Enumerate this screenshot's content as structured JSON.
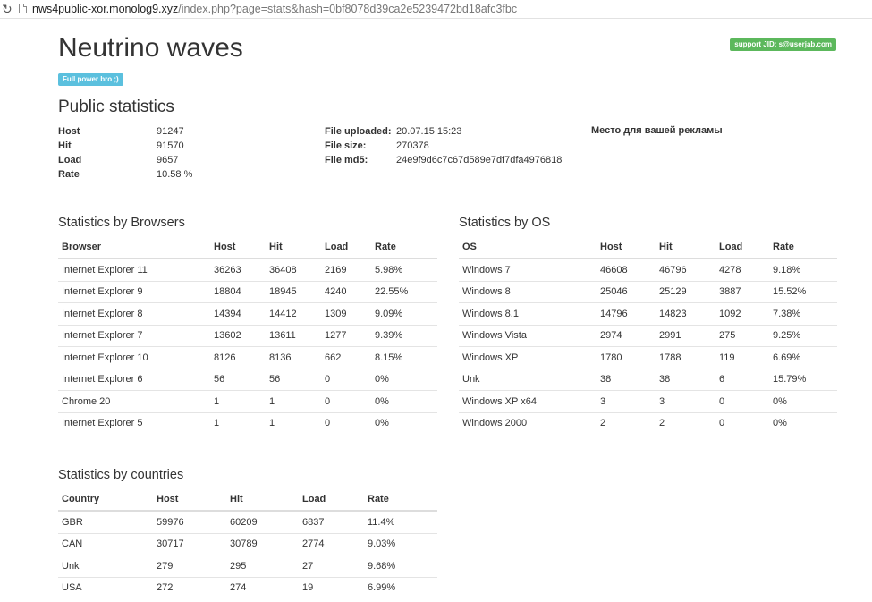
{
  "browser": {
    "url_domain": "nws4public-xor.monolog9.xyz",
    "url_path": "/index.php?page=stats&hash=0bf8078d39ca2e5239472bd18afc3fbc"
  },
  "header": {
    "title": "Neutrino waves",
    "badge": "Full power bro ;)",
    "support": "support JID: s@userjab.com"
  },
  "public_stats": {
    "title": "Public statistics",
    "summary": [
      {
        "label": "Host",
        "value": "91247"
      },
      {
        "label": "Hit",
        "value": "91570"
      },
      {
        "label": "Load",
        "value": "9657"
      },
      {
        "label": "Rate",
        "value": "10.58 %"
      }
    ],
    "file": [
      {
        "label": "File uploaded:",
        "value": "20.07.15 15:23"
      },
      {
        "label": "File size:",
        "value": "270378"
      },
      {
        "label": "File md5:",
        "value": "24e9f9d6c7c67d589e7df7dfa4976818"
      }
    ],
    "ad_text": "Место для вашей рекламы"
  },
  "browsers": {
    "title": "Statistics by Browsers",
    "columns": [
      "Browser",
      "Host",
      "Hit",
      "Load",
      "Rate"
    ],
    "rows": [
      [
        "Internet Explorer 11",
        "36263",
        "36408",
        "2169",
        "5.98%"
      ],
      [
        "Internet Explorer 9",
        "18804",
        "18945",
        "4240",
        "22.55%"
      ],
      [
        "Internet Explorer 8",
        "14394",
        "14412",
        "1309",
        "9.09%"
      ],
      [
        "Internet Explorer 7",
        "13602",
        "13611",
        "1277",
        "9.39%"
      ],
      [
        "Internet Explorer 10",
        "8126",
        "8136",
        "662",
        "8.15%"
      ],
      [
        "Internet Explorer 6",
        "56",
        "56",
        "0",
        "0%"
      ],
      [
        "Chrome 20",
        "1",
        "1",
        "0",
        "0%"
      ],
      [
        "Internet Explorer 5",
        "1",
        "1",
        "0",
        "0%"
      ]
    ]
  },
  "os": {
    "title": "Statistics by OS",
    "columns": [
      "OS",
      "Host",
      "Hit",
      "Load",
      "Rate"
    ],
    "rows": [
      [
        "Windows 7",
        "46608",
        "46796",
        "4278",
        "9.18%"
      ],
      [
        "Windows 8",
        "25046",
        "25129",
        "3887",
        "15.52%"
      ],
      [
        "Windows 8.1",
        "14796",
        "14823",
        "1092",
        "7.38%"
      ],
      [
        "Windows Vista",
        "2974",
        "2991",
        "275",
        "9.25%"
      ],
      [
        "Windows XP",
        "1780",
        "1788",
        "119",
        "6.69%"
      ],
      [
        "Unk",
        "38",
        "38",
        "6",
        "15.79%"
      ],
      [
        "Windows XP x64",
        "3",
        "3",
        "0",
        "0%"
      ],
      [
        "Windows 2000",
        "2",
        "2",
        "0",
        "0%"
      ]
    ]
  },
  "countries": {
    "title": "Statistics by countries",
    "columns": [
      "Country",
      "Host",
      "Hit",
      "Load",
      "Rate"
    ],
    "rows": [
      [
        "GBR",
        "59976",
        "60209",
        "6837",
        "11.4%"
      ],
      [
        "CAN",
        "30717",
        "30789",
        "2774",
        "9.03%"
      ],
      [
        "Unk",
        "279",
        "295",
        "27",
        "9.68%"
      ],
      [
        "USA",
        "272",
        "274",
        "19",
        "6.99%"
      ]
    ]
  }
}
